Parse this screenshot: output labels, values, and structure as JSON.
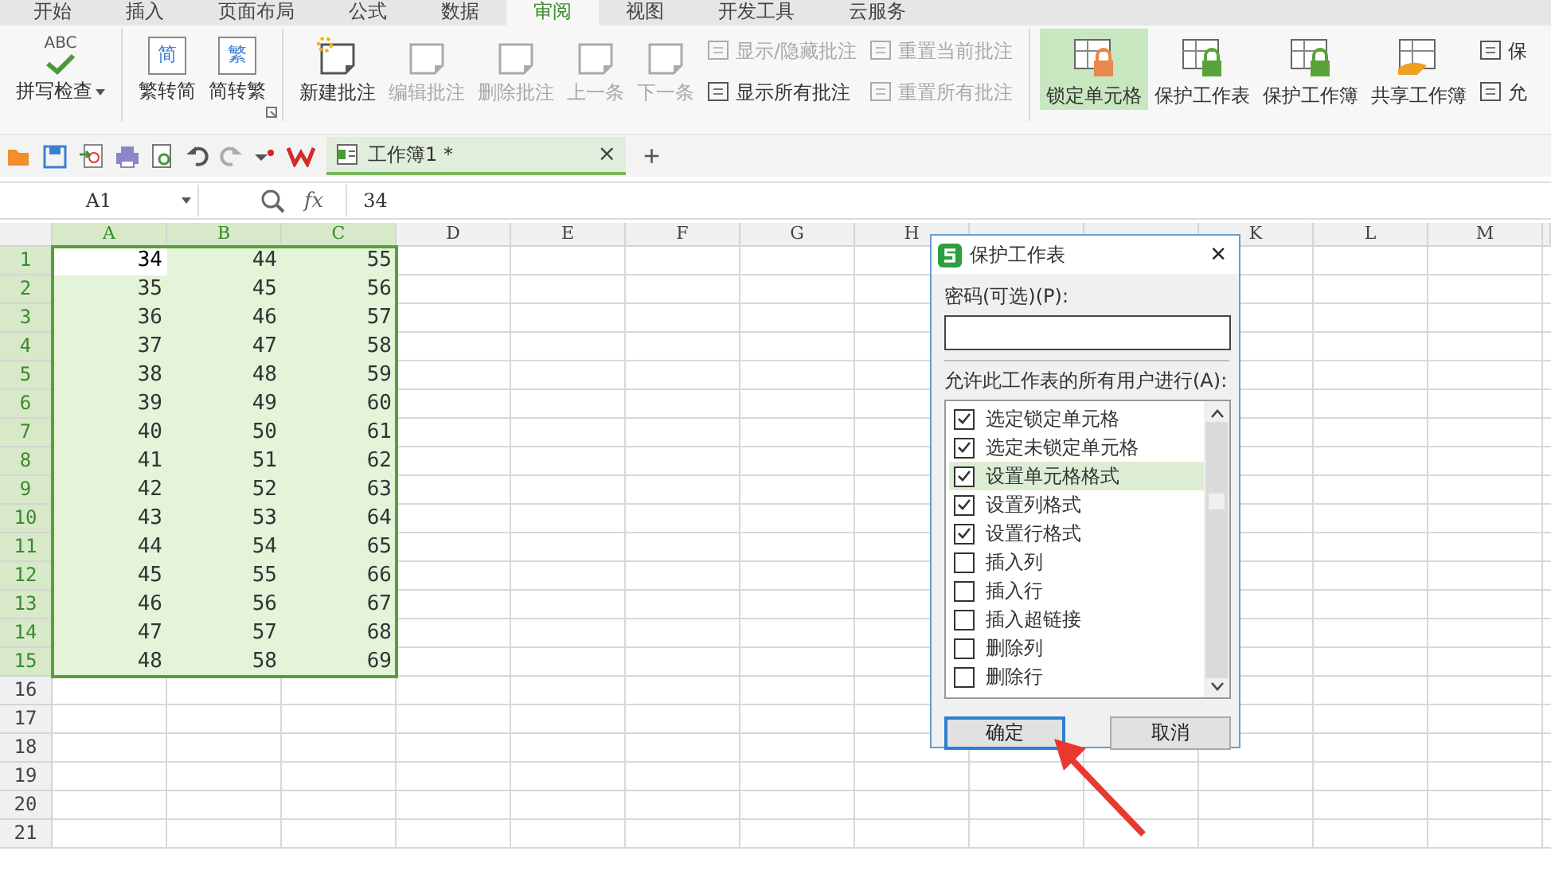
{
  "menu_tabs": [
    {
      "label": "开始",
      "selected": false
    },
    {
      "label": "插入",
      "selected": false
    },
    {
      "label": "页面布局",
      "selected": false
    },
    {
      "label": "公式",
      "selected": false
    },
    {
      "label": "数据",
      "selected": false
    },
    {
      "label": "审阅",
      "selected": true
    },
    {
      "label": "视图",
      "selected": false
    },
    {
      "label": "开发工具",
      "selected": false
    },
    {
      "label": "云服务",
      "selected": false
    }
  ],
  "ribbon": {
    "groups": [
      {
        "launcher": false,
        "items": [
          {
            "kind": "large",
            "label": "拼写检查",
            "icon_text": "ABC",
            "dropdown": true,
            "disabled": false,
            "selected": false
          }
        ]
      },
      {
        "launcher": true,
        "items": [
          {
            "kind": "large",
            "label": "繁转简",
            "icon_text": "简",
            "dropdown": false,
            "disabled": false,
            "selected": false
          },
          {
            "kind": "large",
            "label": "简转繁",
            "icon_text": "繁",
            "dropdown": false,
            "disabled": false,
            "selected": false
          }
        ]
      },
      {
        "launcher": false,
        "items": [
          {
            "kind": "large",
            "label": "新建批注",
            "dropdown": false,
            "disabled": false,
            "selected": false
          },
          {
            "kind": "large",
            "label": "编辑批注",
            "dropdown": false,
            "disabled": true,
            "selected": false
          },
          {
            "kind": "large",
            "label": "删除批注",
            "dropdown": false,
            "disabled": true,
            "selected": false
          },
          {
            "kind": "large",
            "label": "上一条",
            "dropdown": false,
            "disabled": true,
            "selected": false
          },
          {
            "kind": "large",
            "label": "下一条",
            "dropdown": false,
            "disabled": true,
            "selected": false
          },
          {
            "kind": "stack",
            "items": [
              {
                "label": "显示/隐藏批注",
                "disabled": true
              },
              {
                "label": "显示所有批注",
                "disabled": false
              }
            ]
          },
          {
            "kind": "stack",
            "items": [
              {
                "label": "重置当前批注",
                "disabled": true
              },
              {
                "label": "重置所有批注",
                "disabled": true
              }
            ]
          }
        ]
      },
      {
        "launcher": false,
        "items": [
          {
            "kind": "large",
            "label": "锁定单元格",
            "dropdown": false,
            "disabled": false,
            "selected": true
          },
          {
            "kind": "large",
            "label": "保护工作表",
            "dropdown": false,
            "disabled": false,
            "selected": false
          },
          {
            "kind": "large",
            "label": "保护工作簿",
            "dropdown": false,
            "disabled": false,
            "selected": false
          },
          {
            "kind": "large",
            "label": "共享工作簿",
            "dropdown": false,
            "disabled": false,
            "selected": false
          },
          {
            "kind": "stack",
            "items": [
              {
                "label": "保",
                "disabled": false
              },
              {
                "label": "允",
                "disabled": false
              }
            ]
          }
        ]
      }
    ]
  },
  "document_tab": {
    "title": "工作簿1 *",
    "close": "×"
  },
  "new_tab": "+",
  "formula_bar": {
    "name_box": "A1",
    "fx": "fx",
    "value": "34"
  },
  "sheet": {
    "columns": [
      {
        "label": "A",
        "selected": true
      },
      {
        "label": "B",
        "selected": true
      },
      {
        "label": "C",
        "selected": true
      },
      {
        "label": "D",
        "selected": false
      },
      {
        "label": "E",
        "selected": false
      },
      {
        "label": "F",
        "selected": false
      },
      {
        "label": "G",
        "selected": false
      },
      {
        "label": "H",
        "selected": false
      },
      {
        "selected": false
      },
      {
        "selected": false
      },
      {
        "label": "K",
        "selected": false
      },
      {
        "label": "L",
        "selected": false
      },
      {
        "label": "M",
        "selected": false
      }
    ],
    "rows": [
      {
        "header": "1",
        "selected": true,
        "cells": [
          {
            "value": "34",
            "active": true
          },
          "44",
          "55"
        ]
      },
      {
        "header": "2",
        "selected": true,
        "cells": [
          "35",
          "45",
          "56"
        ]
      },
      {
        "header": "3",
        "selected": true,
        "cells": [
          "36",
          "46",
          "57"
        ]
      },
      {
        "header": "4",
        "selected": true,
        "cells": [
          "37",
          "47",
          "58"
        ]
      },
      {
        "header": "5",
        "selected": true,
        "cells": [
          "38",
          "48",
          "59"
        ]
      },
      {
        "header": "6",
        "selected": true,
        "cells": [
          "39",
          "49",
          "60"
        ]
      },
      {
        "header": "7",
        "selected": true,
        "cells": [
          "40",
          "50",
          "61"
        ]
      },
      {
        "header": "8",
        "selected": true,
        "cells": [
          "41",
          "51",
          "62"
        ]
      },
      {
        "header": "9",
        "selected": true,
        "cells": [
          "42",
          "52",
          "63"
        ]
      },
      {
        "header": "10",
        "selected": true,
        "cells": [
          "43",
          "53",
          "64"
        ]
      },
      {
        "header": "11",
        "selected": true,
        "cells": [
          "44",
          "54",
          "65"
        ]
      },
      {
        "header": "12",
        "selected": true,
        "cells": [
          "45",
          "55",
          "66"
        ]
      },
      {
        "header": "13",
        "selected": true,
        "cells": [
          "46",
          "56",
          "67"
        ]
      },
      {
        "header": "14",
        "selected": true,
        "cells": [
          "47",
          "57",
          "68"
        ]
      },
      {
        "header": "15",
        "selected": true,
        "cells": [
          "48",
          "58",
          "69"
        ]
      },
      {
        "header": "16",
        "selected": false,
        "cells": []
      },
      {
        "header": "17",
        "selected": false,
        "cells": []
      },
      {
        "header": "18",
        "selected": false,
        "cells": []
      },
      {
        "header": "19",
        "selected": false,
        "cells": []
      },
      {
        "header": "20",
        "selected": false,
        "cells": []
      },
      {
        "header": "21",
        "selected": false,
        "cells": []
      }
    ]
  },
  "dialog": {
    "title": "保护工作表",
    "close": "×",
    "password_label": "密码(可选)(P):",
    "permissions_label": "允许此工作表的所有用户进行(A):",
    "options": [
      {
        "label": "选定锁定单元格",
        "checked": true,
        "selected": false
      },
      {
        "label": "选定未锁定单元格",
        "checked": true,
        "selected": false
      },
      {
        "label": "设置单元格格式",
        "checked": true,
        "selected": true
      },
      {
        "label": "设置列格式",
        "checked": true,
        "selected": false
      },
      {
        "label": "设置行格式",
        "checked": true,
        "selected": false
      },
      {
        "label": "插入列",
        "checked": false,
        "selected": false
      },
      {
        "label": "插入行",
        "checked": false,
        "selected": false
      },
      {
        "label": "插入超链接",
        "checked": false,
        "selected": false
      },
      {
        "label": "删除列",
        "checked": false,
        "selected": false
      },
      {
        "label": "删除行",
        "checked": false,
        "selected": false
      }
    ],
    "buttons": [
      {
        "label": "确定",
        "default": true
      },
      {
        "label": "取消",
        "default": false
      }
    ]
  }
}
